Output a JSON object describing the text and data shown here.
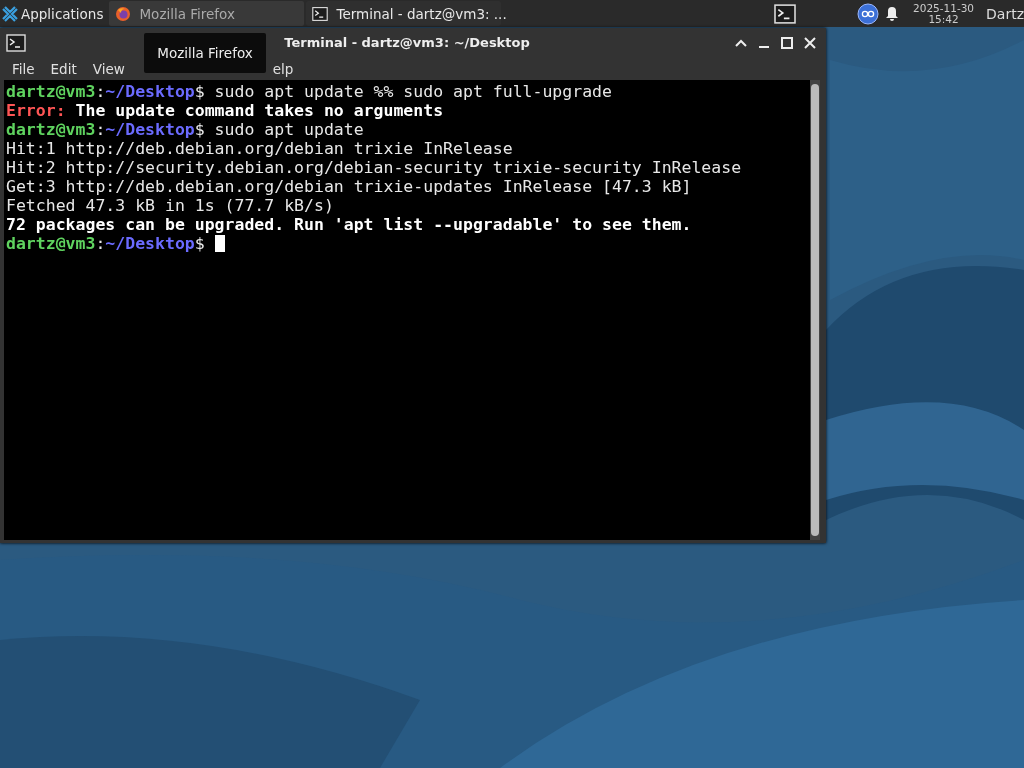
{
  "panel": {
    "apps_label": "Applications",
    "tasks": [
      {
        "title": "Mozilla Firefox",
        "kind": "firefox",
        "selected": false
      },
      {
        "title": "Terminal - dartz@vm3: ...",
        "kind": "terminal",
        "selected": true
      }
    ],
    "clock": {
      "date": "2025-11-30",
      "time": "15:42"
    },
    "user": "Dartz"
  },
  "tooltip": "Mozilla Firefox",
  "window": {
    "title": "Terminal - dartz@vm3: ~/Desktop",
    "menu": [
      "File",
      "Edit",
      "View"
    ],
    "menu_partial": "elp",
    "lines": [
      [
        {
          "kind": "user",
          "text": "dartz@vm3"
        },
        {
          "kind": "plain",
          "text": ":"
        },
        {
          "kind": "path",
          "text": "~/Desktop"
        },
        {
          "kind": "plain",
          "text": "$ sudo apt update %% sudo apt full-upgrade"
        }
      ],
      [
        {
          "kind": "error",
          "text": "Error:"
        },
        {
          "kind": "bold",
          "text": " The update command takes no arguments"
        }
      ],
      [
        {
          "kind": "user",
          "text": "dartz@vm3"
        },
        {
          "kind": "plain",
          "text": ":"
        },
        {
          "kind": "path",
          "text": "~/Desktop"
        },
        {
          "kind": "plain",
          "text": "$ sudo apt update"
        }
      ],
      [
        {
          "kind": "plain",
          "text": "Hit:1 http://deb.debian.org/debian trixie InRelease"
        }
      ],
      [
        {
          "kind": "plain",
          "text": "Hit:2 http://security.debian.org/debian-security trixie-security InRelease"
        }
      ],
      [
        {
          "kind": "plain",
          "text": "Get:3 http://deb.debian.org/debian trixie-updates InRelease [47.3 kB]"
        }
      ],
      [
        {
          "kind": "plain",
          "text": "Fetched 47.3 kB in 1s (77.7 kB/s)"
        }
      ],
      [
        {
          "kind": "bold",
          "text": "72 packages can be upgraded. Run 'apt list --upgradable' to see them."
        }
      ],
      [
        {
          "kind": "user",
          "text": "dartz@vm3"
        },
        {
          "kind": "plain",
          "text": ":"
        },
        {
          "kind": "path",
          "text": "~/Desktop"
        },
        {
          "kind": "plain",
          "text": "$ "
        },
        {
          "kind": "cursor"
        }
      ]
    ]
  }
}
